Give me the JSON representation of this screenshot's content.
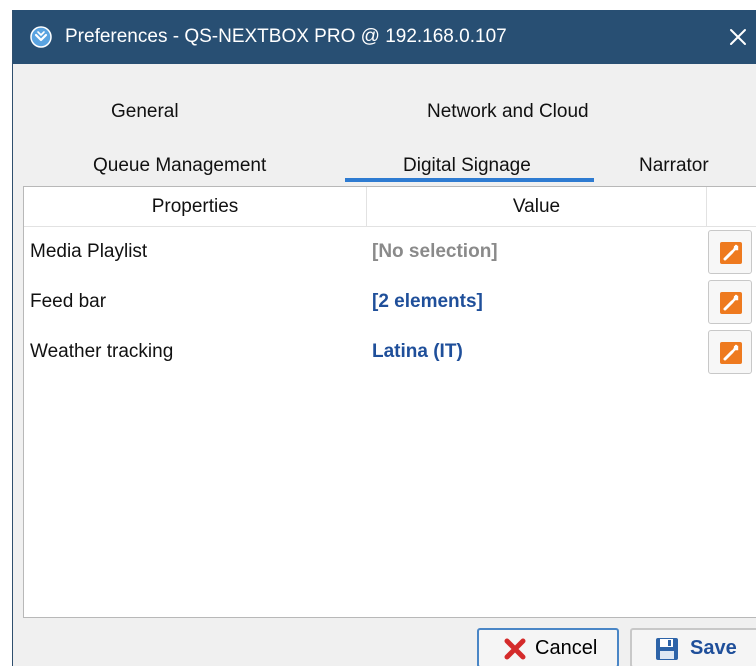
{
  "window": {
    "title": "Preferences - QS-NEXTBOX PRO @ 192.168.0.107",
    "close_glyph": "✕"
  },
  "tabs": [
    {
      "label": "General",
      "active": false
    },
    {
      "label": "Network and Cloud",
      "active": false
    },
    {
      "label": "Queue Management",
      "active": false
    },
    {
      "label": "Digital Signage",
      "active": true
    },
    {
      "label": "Narrator",
      "active": false
    }
  ],
  "grid": {
    "headers": {
      "properties": "Properties",
      "value": "Value"
    },
    "rows": [
      {
        "property": "Media Playlist",
        "value": "[No selection]",
        "value_color": "#8a8a8a"
      },
      {
        "property": "Feed bar",
        "value": "[2 elements]",
        "value_color": "#1f4f9a"
      },
      {
        "property": "Weather tracking",
        "value": "Latina (IT)",
        "value_color": "#1f4f9a"
      }
    ],
    "edit_icon": "wrench-icon"
  },
  "buttons": {
    "cancel_label": "Cancel",
    "save_label": "Save"
  },
  "colors": {
    "titlebar": "#284f73",
    "accent": "#2e7bd1",
    "edit_button": "#ee7a1f",
    "cancel_icon": "#d42a2a",
    "save_icon": "#2d63a8"
  }
}
